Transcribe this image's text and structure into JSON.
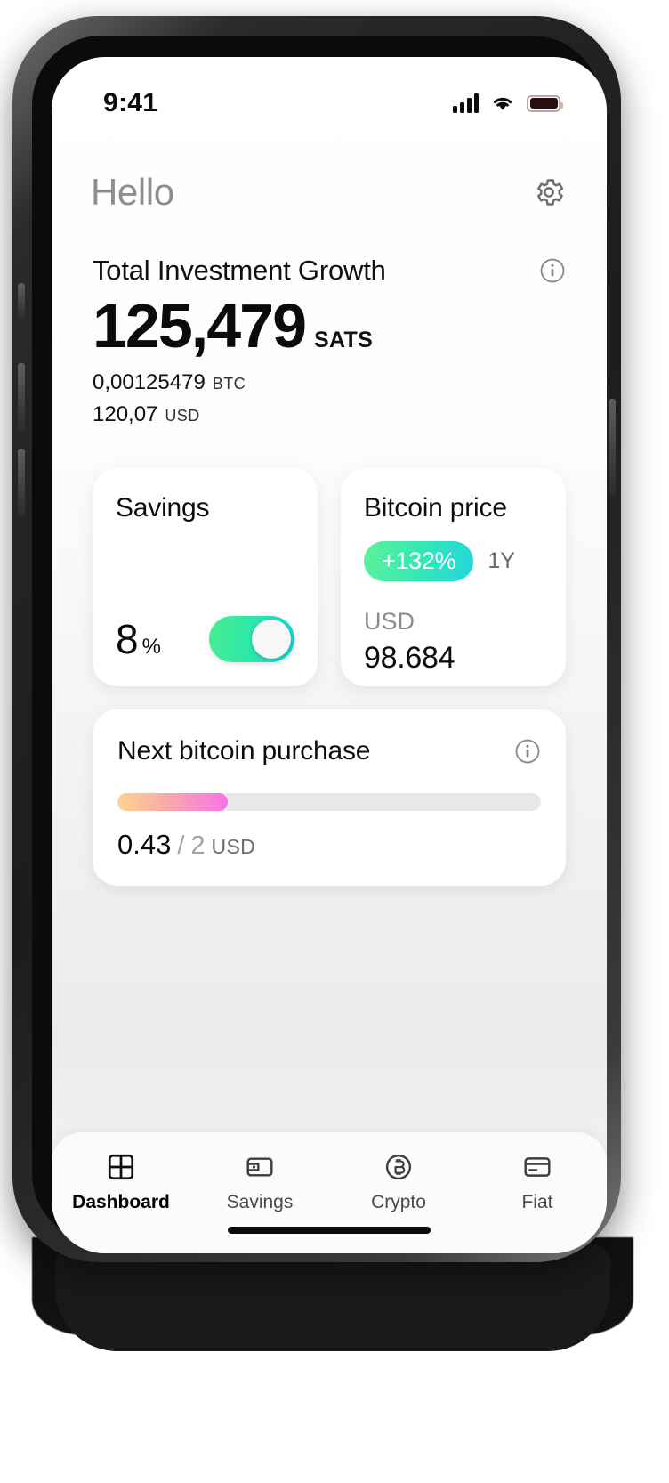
{
  "status_bar": {
    "time": "9:41",
    "signal_icon": "cellular-signal-icon",
    "wifi_icon": "wifi-icon",
    "battery_icon": "battery-icon"
  },
  "header": {
    "greeting": "Hello",
    "settings_icon": "gear-icon"
  },
  "hero": {
    "title": "Total Investment Growth",
    "info_icon": "info-icon",
    "amount": "125,479",
    "unit": "SATS",
    "btc_value": "0,00125479",
    "btc_unit": "BTC",
    "usd_value": "120,07",
    "usd_unit": "USD"
  },
  "savings_card": {
    "title": "Savings",
    "percent_value": "8",
    "percent_symbol": "%",
    "toggle_on": true,
    "toggle_gradient_from": "#4bec8f",
    "toggle_gradient_to": "#12d8d8"
  },
  "bitcoin_card": {
    "title": "Bitcoin price",
    "change_badge": "+132%",
    "period": "1Y",
    "currency": "USD",
    "price": "98.684",
    "badge_gradient_from": "#5df29a",
    "badge_gradient_to": "#22d6dd"
  },
  "next_purchase_card": {
    "title": "Next bitcoin purchase",
    "info_icon": "info-icon",
    "progress_percent": 26,
    "current": "0.43",
    "separator": "/",
    "total": "2",
    "currency": "USD",
    "bar_gradient_from": "#fcd392",
    "bar_gradient_to": "#f772e8"
  },
  "tabbar": {
    "items": [
      {
        "label": "Dashboard",
        "icon": "dashboard-grid-icon",
        "active": true
      },
      {
        "label": "Savings",
        "icon": "wallet-icon",
        "active": false
      },
      {
        "label": "Crypto",
        "icon": "bitcoin-circle-icon",
        "active": false
      },
      {
        "label": "Fiat",
        "icon": "card-icon",
        "active": false
      }
    ]
  }
}
